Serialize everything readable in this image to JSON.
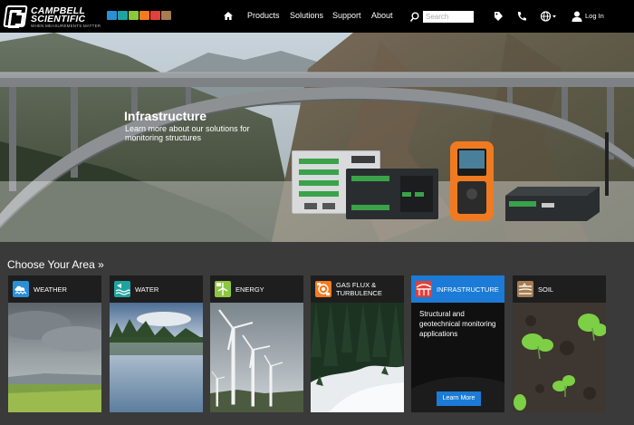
{
  "header": {
    "logo_line1": "CAMPBELL",
    "logo_line2": "SCIENTIFIC",
    "logo_tagline": "WHEN MEASUREMENTS MATTER",
    "area_icon_colors": [
      "#2b8fd6",
      "#1fa3a0",
      "#8dc63f",
      "#f47b20",
      "#e2403a",
      "#a67c52"
    ],
    "home_icon": "home-icon",
    "nav": {
      "products": "Products",
      "solutions": "Solutions",
      "support": "Support",
      "about": "About"
    },
    "search_placeholder": "Search",
    "login_label": "Log In",
    "icons": [
      "search-icon",
      "tag-icon",
      "phone-icon",
      "globe-icon",
      "user-icon"
    ]
  },
  "hero": {
    "title": "Infrastructure",
    "subtitle": "Learn more about our solutions for monitoring structures"
  },
  "areas": {
    "title": "Choose Your Area »",
    "cards": [
      {
        "label": "WEATHER",
        "color": "#2b8fd6"
      },
      {
        "label": "WATER",
        "color": "#1fa3a0"
      },
      {
        "label": "ENERGY",
        "color": "#8dc63f"
      },
      {
        "label": "GAS FLUX & TURBULENCE",
        "color": "#f47b20"
      },
      {
        "label": "INFRASTRUCTURE",
        "color": "#e2403a",
        "description": "Structural and geotechnical monitoring applications",
        "button": "Learn More"
      },
      {
        "label": "SOIL",
        "color": "#a67c52"
      }
    ]
  },
  "colors": {
    "accent": "#1b7bd6",
    "header_bg": "#000000",
    "page_bg": "#3a3a3a"
  }
}
